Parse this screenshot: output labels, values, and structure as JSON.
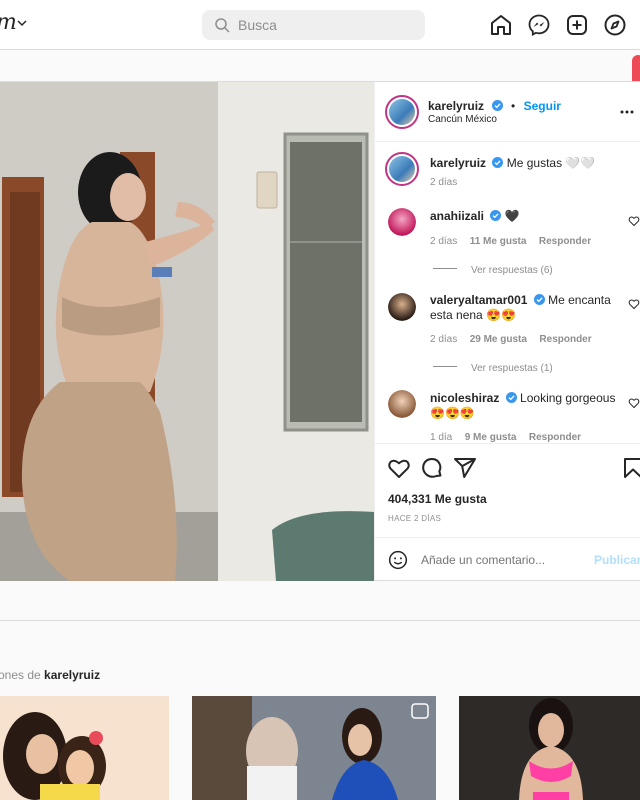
{
  "nav": {
    "brand_text": "m",
    "search_placeholder": "Busca",
    "icons": [
      "home-icon",
      "messenger-icon",
      "new-post-icon",
      "explore-icon"
    ]
  },
  "post": {
    "author": "karelyruiz",
    "follow_label": "Seguir",
    "dot": "•",
    "location": "Cancún México",
    "caption_user": "karelyruiz",
    "caption_text": "Me gustas 🤍🤍",
    "caption_time": "2 días",
    "likes": "404,331 Me gusta",
    "posted_ago": "HACE 2 DÍAS",
    "comment_placeholder": "Añade un comentario...",
    "publish_label": "Publicar"
  },
  "comments": [
    {
      "user": "anahiizali",
      "text": "🖤",
      "time": "2 días",
      "likes": "11 Me gusta",
      "reply": "Responder",
      "view_replies": "Ver respuestas (6)"
    },
    {
      "user": "valeryaltamar001",
      "text": "Me encanta esta nena 😍😍",
      "time": "2 días",
      "likes": "29 Me gusta",
      "reply": "Responder",
      "view_replies": "Ver respuestas (1)"
    },
    {
      "user": "nicoleshiraz",
      "text": "Looking gorgeous 😍😍😍",
      "time": "1 día",
      "likes": "9 Me gusta",
      "reply": "Responder"
    }
  ],
  "more_section": {
    "prefix": "ones de",
    "user": "karelyruiz"
  },
  "colors": {
    "accent": "#0095f6",
    "verified": "#3897f0",
    "notification": "#ed4956"
  }
}
